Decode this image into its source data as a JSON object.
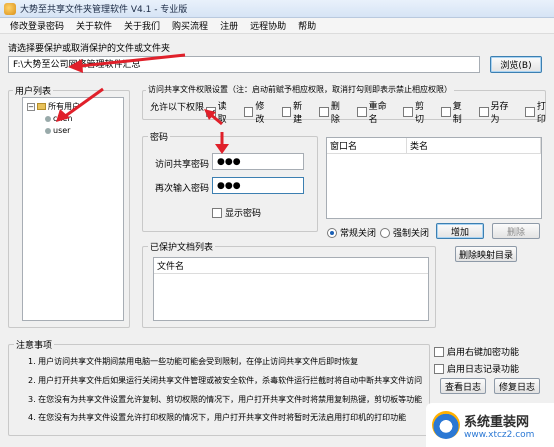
{
  "window": {
    "title": "大势至共享文件夹管理软件 V4.1 - 专业版"
  },
  "menu": [
    "修改登录密码",
    "关于软件",
    "关于我们",
    "购买流程",
    "注册",
    "远程协助",
    "帮助"
  ],
  "folder_select": {
    "label": "请选择要保护或取消保护的文件或文件夹",
    "path_value": "F:\\大势至公司网络管理软件汇总",
    "browse_button": "浏览(B)"
  },
  "user_list": {
    "title": "用户列表",
    "root": "所有用户",
    "users": [
      "chen",
      "user"
    ]
  },
  "permissions": {
    "title": "访问共享文件权限设置（注：启动前赋予相应权限，取消打勾则即表示禁止相应权限）",
    "allow_label": "允许以下权限",
    "items": [
      {
        "label": "读取",
        "checked": true
      },
      {
        "label": "修改",
        "checked": false
      },
      {
        "label": "新建",
        "checked": false
      },
      {
        "label": "删除",
        "checked": false
      },
      {
        "label": "重命名",
        "checked": false
      },
      {
        "label": "剪切",
        "checked": false
      },
      {
        "label": "复制",
        "checked": false
      },
      {
        "label": "另存为",
        "checked": false
      },
      {
        "label": "打印",
        "checked": false
      }
    ]
  },
  "password": {
    "title": "密码",
    "access_label": "访问共享密码",
    "access_value": "●●●",
    "confirm_label": "再次输入密码",
    "confirm_value": "●●●",
    "show_label": "显示密码"
  },
  "window_table": {
    "columns": [
      "窗口名",
      "类名"
    ]
  },
  "close_mode": {
    "options": [
      {
        "label": "常规关闭",
        "selected": true
      },
      {
        "label": "强制关闭",
        "selected": false
      }
    ],
    "add_button": "增加",
    "delete_button": "删除"
  },
  "protected_list": {
    "title": "已保护文档列表",
    "column": "文件名",
    "clear_button": "删除映射目录"
  },
  "notes": {
    "title": "注意事项",
    "items": [
      "1. 用户访问共享文件期间禁用电脑一些功能可能会受到限制，在停止访问共享文件后即时恢复",
      "2. 用户打开共享文件后如果运行关闭共享文件管理或被安全软件，杀毒软件运行拦截时将自动中断共享文件访问",
      "3. 在您没有为共享文件设置允许复制、剪切权限的情况下，用户打开共享文件时将禁用复制热键，剪切板等功能",
      "4. 在您没有为共享文件设置允许打印权限的情况下，用户打开共享文件时将暂时无法启用打印机的打印功能"
    ]
  },
  "options": {
    "right_click": "启用右键加密功能",
    "log": "启用日志记录功能",
    "view_log": "查看日志",
    "edit_log": "修复日志"
  },
  "watermark": {
    "name": "系统重装网",
    "url": "www.xtcz2.com"
  },
  "colors": {
    "accent": "#3c7fb1",
    "annotation": "#e0202a",
    "background": "#f0f0f0"
  }
}
